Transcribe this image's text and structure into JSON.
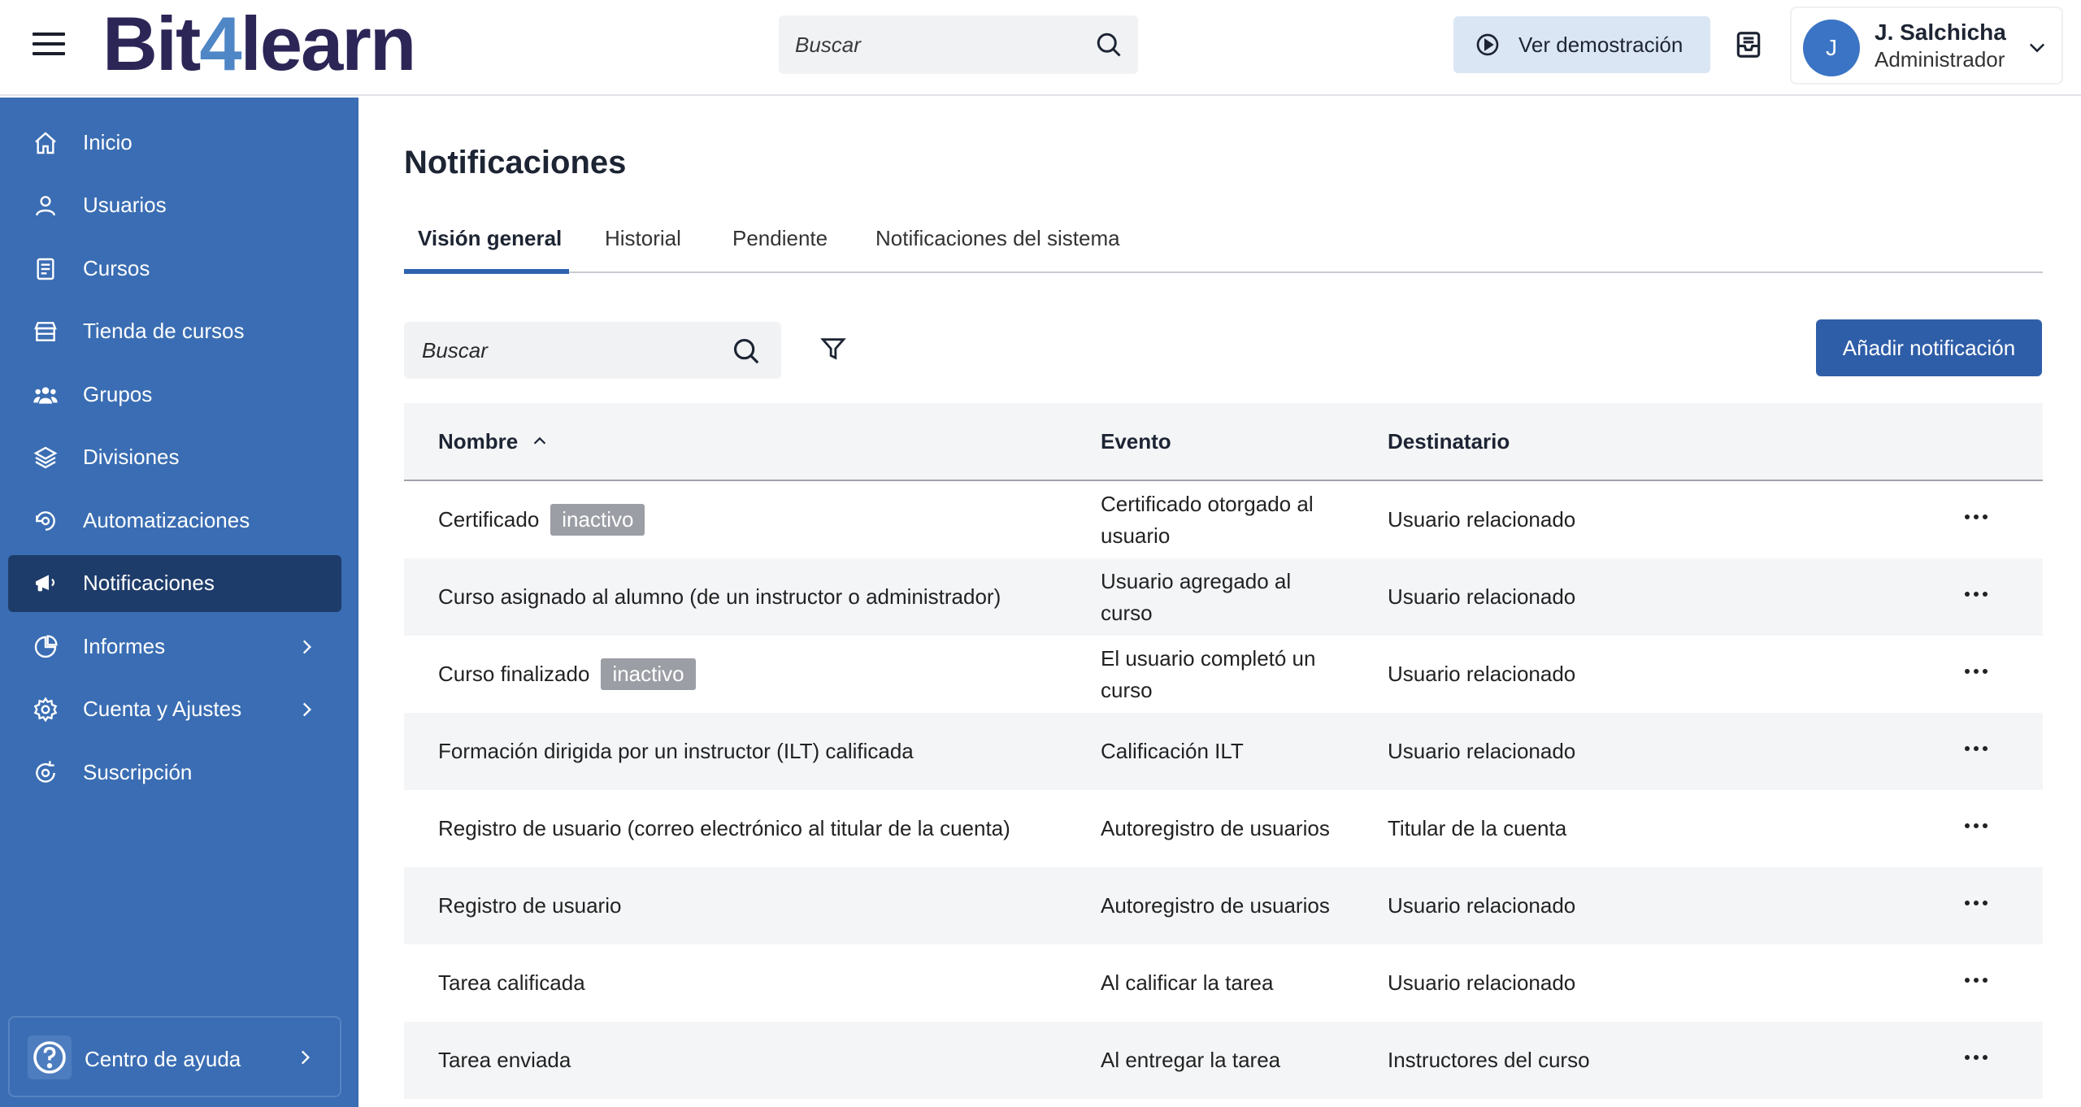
{
  "header": {
    "logo_pre": "Bit",
    "logo_four": "4",
    "logo_post": "learn",
    "search_placeholder": "Buscar",
    "demo_label": "Ver demostración",
    "user_name": "J. Salchicha",
    "user_role": "Administrador",
    "avatar_initial": "J"
  },
  "sidebar": {
    "items": [
      {
        "label": "Inicio",
        "icon": "home-icon"
      },
      {
        "label": "Usuarios",
        "icon": "user-icon"
      },
      {
        "label": "Cursos",
        "icon": "book-icon"
      },
      {
        "label": "Tienda de cursos",
        "icon": "store-icon"
      },
      {
        "label": "Grupos",
        "icon": "group-icon"
      },
      {
        "label": "Divisiones",
        "icon": "layers-icon"
      },
      {
        "label": "Automatizaciones",
        "icon": "automation-icon"
      },
      {
        "label": "Notificaciones",
        "icon": "megaphone-icon",
        "active": true
      },
      {
        "label": "Informes",
        "icon": "pie-chart-icon",
        "expandable": true
      },
      {
        "label": "Cuenta y Ajustes",
        "icon": "gear-icon",
        "expandable": true
      },
      {
        "label": "Suscripción",
        "icon": "subscription-icon"
      }
    ],
    "help_label": "Centro de ayuda"
  },
  "main": {
    "title": "Notificaciones",
    "tabs": [
      {
        "label": "Visión general",
        "active": true
      },
      {
        "label": "Historial"
      },
      {
        "label": "Pendiente"
      },
      {
        "label": "Notificaciones del sistema"
      }
    ],
    "search_placeholder": "Buscar",
    "add_button": "Añadir notificación",
    "table": {
      "headers": {
        "name": "Nombre",
        "event": "Evento",
        "recipient": "Destinatario"
      },
      "rows": [
        {
          "name": "Certificado",
          "badge": "inactivo",
          "event": "Certificado otorgado al usuario",
          "recipient": "Usuario relacionado"
        },
        {
          "name": "Curso asignado al alumno (de un instructor o administrador)",
          "badge": "",
          "event": "Usuario agregado al curso",
          "recipient": "Usuario relacionado"
        },
        {
          "name": "Curso finalizado",
          "badge": "inactivo",
          "event": "El usuario completó un curso",
          "recipient": "Usuario relacionado"
        },
        {
          "name": "Formación dirigida por un instructor (ILT) calificada",
          "badge": "",
          "event": "Calificación ILT",
          "recipient": "Usuario relacionado"
        },
        {
          "name": "Registro de usuario (correo electrónico al titular de la cuenta)",
          "badge": "",
          "event": "Autoregistro de usuarios",
          "recipient": "Titular de la cuenta"
        },
        {
          "name": "Registro de usuario",
          "badge": "",
          "event": "Autoregistro de usuarios",
          "recipient": "Usuario relacionado"
        },
        {
          "name": "Tarea calificada",
          "badge": "",
          "event": "Al calificar la tarea",
          "recipient": "Usuario relacionado"
        },
        {
          "name": "Tarea enviada",
          "badge": "",
          "event": "Al entregar la tarea",
          "recipient": "Instructores del curso"
        }
      ]
    }
  },
  "colors": {
    "sidebar_bg": "#3a6db3",
    "sidebar_active": "#1e3c6a",
    "primary_button": "#2f5ea8",
    "logo_dark": "#2c2657",
    "logo_accent": "#4f86c6",
    "badge_bg": "#9b9ea4"
  }
}
